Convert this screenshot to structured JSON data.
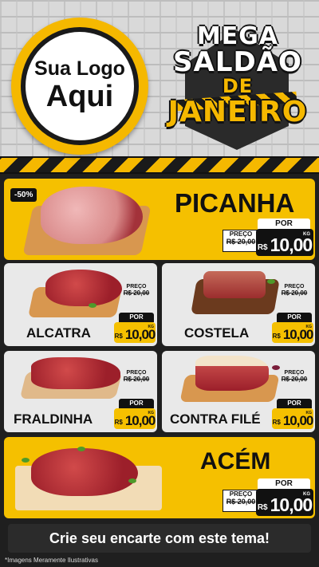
{
  "logo": {
    "line1": "Sua Logo",
    "line2": "Aqui"
  },
  "campaign": {
    "line1": "MEGA",
    "line2": "SALDÃO",
    "line3": "DE",
    "line4": "JANEIRO"
  },
  "products": [
    {
      "name": "PICANHA",
      "badge": "-50%",
      "price_label": "PREÇO",
      "old_price": "R$ 20,00",
      "por": "POR",
      "currency": "R$",
      "price": "10,00",
      "unit": "KG"
    },
    {
      "name": "ALCATRA",
      "price_label": "PREÇO",
      "old_price": "R$ 20,00",
      "por": "POR",
      "currency": "R$",
      "price": "10,00",
      "unit": "KG"
    },
    {
      "name": "COSTELA",
      "price_label": "PREÇO",
      "old_price": "R$ 20,00",
      "por": "POR",
      "currency": "R$",
      "price": "10,00",
      "unit": "KG"
    },
    {
      "name": "FRALDINHA",
      "price_label": "PREÇO",
      "old_price": "R$ 20,00",
      "por": "POR",
      "currency": "R$",
      "price": "10,00",
      "unit": "KG"
    },
    {
      "name": "CONTRA FILÉ",
      "price_label": "PREÇO",
      "old_price": "R$ 20,00",
      "por": "POR",
      "currency": "R$",
      "price": "10,00",
      "unit": "KG"
    },
    {
      "name": "ACÉM",
      "price_label": "PREÇO",
      "old_price": "R$ 20,00",
      "por": "POR",
      "currency": "R$",
      "price": "10,00",
      "unit": "KG"
    }
  ],
  "cta": "Crie seu encarte com este tema!",
  "footnote": "*Imagens Meramente Ilustrativas",
  "colors": {
    "yellow": "#f5c000",
    "dark": "#1f1f1f",
    "gray_card": "#e9e9e9"
  }
}
